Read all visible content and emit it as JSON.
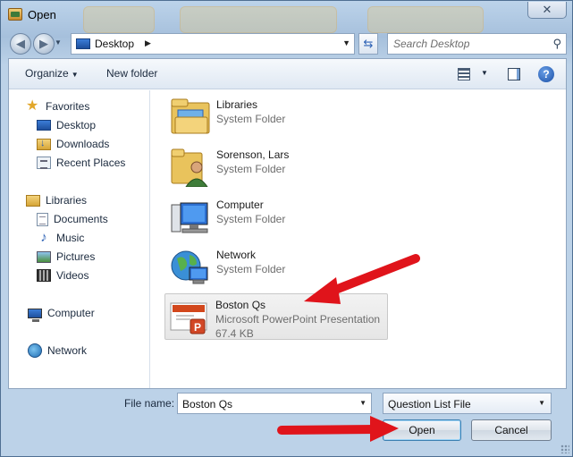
{
  "window": {
    "title": "Open",
    "close_glyph": "✕"
  },
  "navigation": {
    "back_glyph": "◀",
    "forward_glyph": "▶",
    "address": {
      "icon": "desktop-icon",
      "current": "Desktop"
    },
    "search_placeholder": "Search Desktop"
  },
  "toolbar": {
    "organize_label": "Organize",
    "new_folder_label": "New folder"
  },
  "sidebar": {
    "favorites_label": "Favorites",
    "favorites": [
      {
        "label": "Desktop",
        "icon": "desktop-icon"
      },
      {
        "label": "Downloads",
        "icon": "downloads-folder-icon"
      },
      {
        "label": "Recent Places",
        "icon": "recent-places-icon"
      }
    ],
    "libraries_label": "Libraries",
    "libraries": [
      {
        "label": "Documents",
        "icon": "documents-icon"
      },
      {
        "label": "Music",
        "icon": "music-icon"
      },
      {
        "label": "Pictures",
        "icon": "pictures-icon"
      },
      {
        "label": "Videos",
        "icon": "videos-icon"
      }
    ],
    "computer_label": "Computer",
    "network_label": "Network"
  },
  "files": [
    {
      "name": "Libraries",
      "type": "System Folder",
      "icon": "libraries-folder-icon"
    },
    {
      "name": "Sorenson, Lars",
      "type": "System Folder",
      "icon": "user-folder-icon"
    },
    {
      "name": "Computer",
      "type": "System Folder",
      "icon": "computer-icon"
    },
    {
      "name": "Network",
      "type": "System Folder",
      "icon": "network-icon"
    },
    {
      "name": "Boston Qs",
      "type": "Microsoft PowerPoint Presentation",
      "size": "67.4 KB",
      "icon": "powerpoint-file-icon",
      "selected": true
    }
  ],
  "footer": {
    "file_name_label": "File name:",
    "file_name_value": "Boston Qs",
    "file_type_value": "Question List File",
    "open_label": "Open",
    "cancel_label": "Cancel"
  },
  "colors": {
    "annotation_arrow": "#e0141b",
    "selection_bg": "#ececec",
    "window_frame": "#a9c2dd"
  }
}
